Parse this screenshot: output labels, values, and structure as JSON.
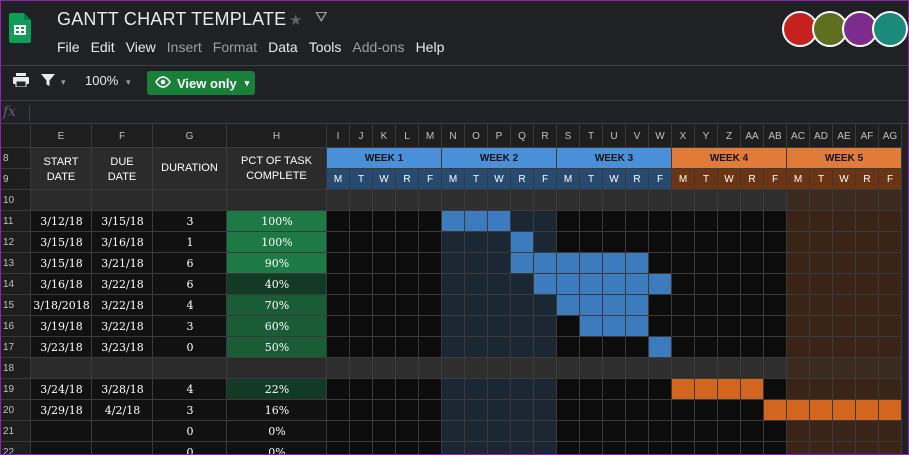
{
  "app": {
    "title": "GANTT CHART TEMPLATE",
    "star_icon": "star-icon",
    "drive_icon": "move-to-drive-icon"
  },
  "menu": {
    "items": [
      "File",
      "Edit",
      "View",
      "Insert",
      "Format",
      "Data",
      "Tools",
      "Add-ons",
      "Help"
    ],
    "dim": [
      3,
      4,
      7
    ]
  },
  "avatars": [
    {
      "color": "#c5221f",
      "icon": "turtle-avatar"
    },
    {
      "color": "#5f6f20",
      "icon": "owl-avatar"
    },
    {
      "color": "#7b2c8c",
      "icon": "cat-avatar"
    },
    {
      "color": "#1a8a7a",
      "icon": "dolphin-avatar"
    }
  ],
  "toolbar": {
    "zoom": "100%",
    "view_only": "View only"
  },
  "formula": {
    "fx": "fx"
  },
  "columns": [
    "E",
    "F",
    "G",
    "H",
    "I",
    "J",
    "K",
    "L",
    "M",
    "N",
    "O",
    "P",
    "Q",
    "R",
    "S",
    "T",
    "U",
    "V",
    "W",
    "X",
    "Y",
    "Z",
    "AA",
    "AB",
    "AC",
    "AD",
    "AE",
    "AF",
    "AG"
  ],
  "rows": [
    "8",
    "9",
    "10",
    "11",
    "12",
    "13",
    "14",
    "15",
    "16",
    "17",
    "18",
    "19",
    "20",
    "21",
    "22"
  ],
  "headers": {
    "start": "START DATE",
    "due": "DUE DATE",
    "duration": "DURATION",
    "pct": "PCT OF TASK COMPLETE"
  },
  "weeks": [
    "WEEK 1",
    "WEEK 2",
    "WEEK 3",
    "WEEK 4",
    "WEEK 5"
  ],
  "days": [
    "M",
    "T",
    "W",
    "R",
    "F"
  ],
  "colors": {
    "blue_week": "#4a90d9",
    "orange_week": "#e07b39",
    "blue_bar": "#3d7bbf",
    "orange_bar": "#d2661f",
    "green_pct": "#1e7a45"
  },
  "tasks": [
    {
      "start": "3/12/18",
      "due": "3/15/18",
      "duration": "3",
      "pct": "100%",
      "pct_value": 1.0,
      "bar_start": 5,
      "bar_len": 3,
      "color": "blue"
    },
    {
      "start": "3/15/18",
      "due": "3/16/18",
      "duration": "1",
      "pct": "100%",
      "pct_value": 1.0,
      "bar_start": 8,
      "bar_len": 1,
      "color": "blue"
    },
    {
      "start": "3/15/18",
      "due": "3/21/18",
      "duration": "6",
      "pct": "90%",
      "pct_value": 0.9,
      "bar_start": 8,
      "bar_len": 6,
      "color": "blue"
    },
    {
      "start": "3/16/18",
      "due": "3/22/18",
      "duration": "6",
      "pct": "40%",
      "pct_value": 0.4,
      "bar_start": 9,
      "bar_len": 6,
      "color": "blue"
    },
    {
      "start": "3/18/2018",
      "due": "3/22/18",
      "duration": "4",
      "pct": "70%",
      "pct_value": 0.7,
      "bar_start": 10,
      "bar_len": 4,
      "color": "blue"
    },
    {
      "start": "3/19/18",
      "due": "3/22/18",
      "duration": "3",
      "pct": "60%",
      "pct_value": 0.6,
      "bar_start": 11,
      "bar_len": 3,
      "color": "blue"
    },
    {
      "start": "3/23/18",
      "due": "3/23/18",
      "duration": "0",
      "pct": "50%",
      "pct_value": 0.5,
      "bar_start": 14,
      "bar_len": 1,
      "color": "blue"
    },
    null,
    {
      "start": "3/24/18",
      "due": "3/28/18",
      "duration": "4",
      "pct": "22%",
      "pct_value": 0.22,
      "bar_start": 15,
      "bar_len": 4,
      "color": "orange"
    },
    {
      "start": "3/29/18",
      "due": "4/2/18",
      "duration": "3",
      "pct": "16%",
      "pct_value": 0.16,
      "bar_start": 19,
      "bar_len": 6,
      "color": "orange"
    },
    {
      "start": "",
      "due": "",
      "duration": "0",
      "pct": "0%",
      "pct_value": 0,
      "bar_start": 0,
      "bar_len": 0,
      "color": "blue"
    },
    {
      "start": "",
      "due": "",
      "duration": "0",
      "pct": "0%",
      "pct_value": 0,
      "bar_start": 0,
      "bar_len": 0,
      "color": "blue"
    }
  ]
}
